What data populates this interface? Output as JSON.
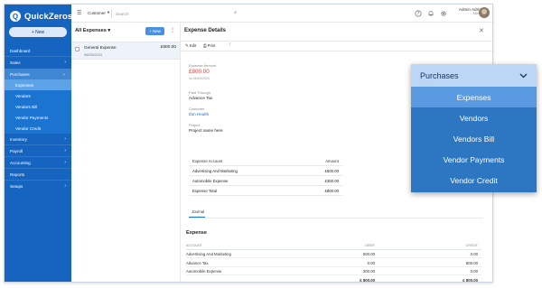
{
  "app": {
    "name": "QuickZeros",
    "new_label": "+ New"
  },
  "sidebar": {
    "items": [
      {
        "label": "Dashboard",
        "chevron": ""
      },
      {
        "label": "Sales",
        "chevron": "›"
      },
      {
        "label": "Purchases",
        "chevron": "⌄"
      },
      {
        "label": "Expenses"
      },
      {
        "label": "Vendors"
      },
      {
        "label": "Vendors Bill"
      },
      {
        "label": "Vendor Payments"
      },
      {
        "label": "Vendor Credit"
      },
      {
        "label": "Inventory",
        "chevron": "›"
      },
      {
        "label": "Payroll",
        "chevron": "›"
      },
      {
        "label": "Accounting",
        "chevron": "›"
      },
      {
        "label": "Reports",
        "chevron": ""
      },
      {
        "label": "Setups",
        "chevron": "›"
      }
    ]
  },
  "topbar": {
    "org": "Customer",
    "search_placeholder": "Search",
    "user_name": "Admin Admin",
    "user_role": "ADMIN"
  },
  "list": {
    "title": "All Expenses",
    "new_label": "+ New",
    "row": {
      "name": "General Expense",
      "date": "06/05/2024",
      "amount": "£800.00"
    }
  },
  "detail": {
    "title": "Expense Details",
    "toolbar": {
      "edit": "Edit",
      "print": "Print"
    },
    "amount_label": "Expense Amount",
    "amount": "£800.00",
    "amount_date": "on 06/05/2024",
    "paid_through_label": "Paid Through",
    "paid_through": "Advance Tax",
    "customer_label": "Customer",
    "customer": "Ifan Health",
    "project_label": "Project",
    "project": "Project name here",
    "table": {
      "headers": [
        "Expense Account",
        "Amount"
      ],
      "rows": [
        [
          "Advertising And Marketing",
          "£500.00"
        ],
        [
          "Automobile Expense",
          "£300.00"
        ],
        [
          "Expense Total",
          "£800.00"
        ]
      ]
    },
    "journal_tab": "Journal",
    "journal_title": "Expense",
    "journal": {
      "headers": [
        "ACCOUNT",
        "DEBIT",
        "CREDIT"
      ],
      "rows": [
        [
          "Advertising And Marketing",
          "500.00",
          "0.00"
        ],
        [
          "Advance Tax",
          "0.00",
          "800.00"
        ],
        [
          "Automobile Expense",
          "300.00",
          "0.00"
        ]
      ],
      "totals": [
        "",
        "£ 800.00",
        "£ 800.00"
      ]
    }
  },
  "zoom": {
    "header": "Purchases",
    "items": [
      "Expenses",
      "Vendors",
      "Vendors Bill",
      "Vendor Payments",
      "Vendor Credit"
    ]
  }
}
